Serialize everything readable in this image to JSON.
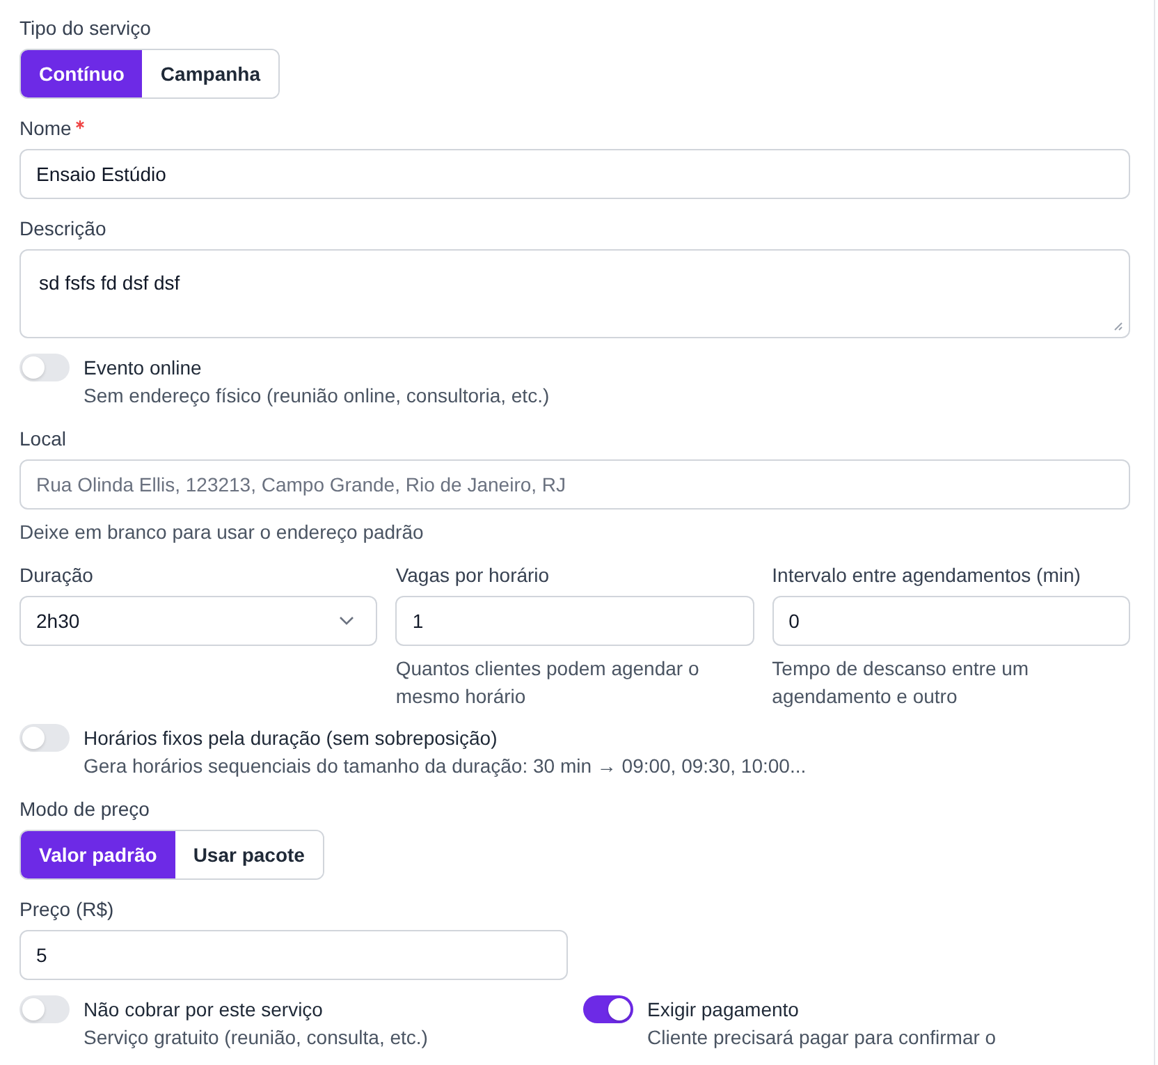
{
  "service_type": {
    "label": "Tipo do serviço",
    "options": [
      {
        "label": "Contínuo",
        "selected": true
      },
      {
        "label": "Campanha",
        "selected": false
      }
    ]
  },
  "name": {
    "label": "Nome",
    "required": true,
    "value": "Ensaio Estúdio"
  },
  "description": {
    "label": "Descrição",
    "value": "sd fsfs fd dsf dsf"
  },
  "online_event": {
    "label": "Evento online",
    "hint": "Sem endereço físico (reunião online, consultoria, etc.)",
    "on": false
  },
  "location": {
    "label": "Local",
    "placeholder": "Rua Olinda Ellis, 123213, Campo Grande, Rio de Janeiro, RJ",
    "hint": "Deixe em branco para usar o endereço padrão"
  },
  "duration": {
    "label": "Duração",
    "value": "2h30"
  },
  "slots": {
    "label": "Vagas por horário",
    "value": "1",
    "hint": "Quantos clientes podem agendar o mesmo horário"
  },
  "interval": {
    "label": "Intervalo entre agendamentos (min)",
    "value": "0",
    "hint": "Tempo de descanso entre um agendamento e outro"
  },
  "fixed_slots": {
    "label": "Horários fixos pela duração (sem sobreposição)",
    "hint": "Gera horários sequenciais do tamanho da duração: 30 min → 09:00, 09:30, 10:00...",
    "on": false
  },
  "price_mode": {
    "label": "Modo de preço",
    "options": [
      {
        "label": "Valor padrão",
        "selected": true
      },
      {
        "label": "Usar pacote",
        "selected": false
      }
    ]
  },
  "price": {
    "label": "Preço (R$)",
    "value": "5"
  },
  "free": {
    "label": "Não cobrar por este serviço",
    "hint": "Serviço gratuito (reunião, consulta, etc.)",
    "on": false
  },
  "require_payment": {
    "label": "Exigir pagamento",
    "hint": "Cliente precisará pagar para confirmar o",
    "on": true
  }
}
